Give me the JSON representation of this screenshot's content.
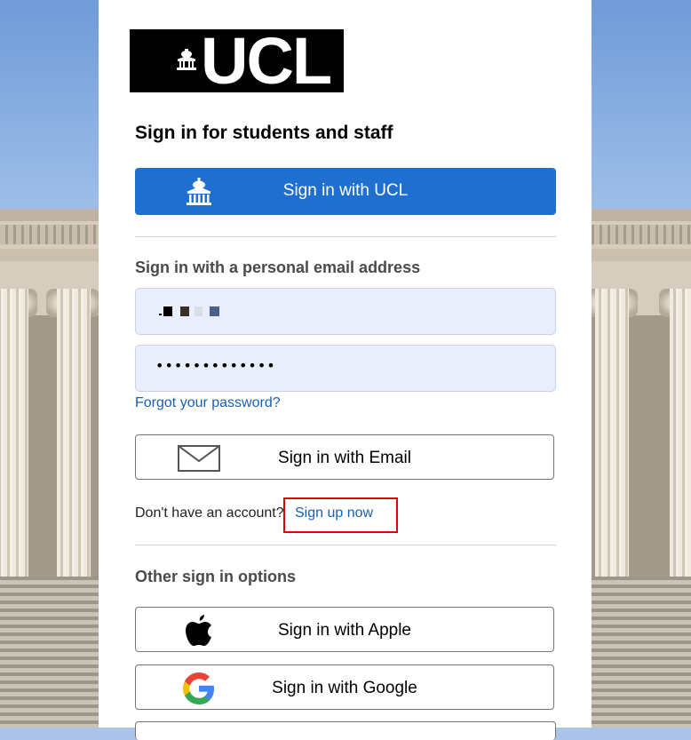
{
  "logo": {
    "text": "UCL"
  },
  "title": "Sign in for students and staff",
  "ucl_button": {
    "label": "Sign in with UCL",
    "icon": "portico-icon"
  },
  "personal_section": {
    "heading": "Sign in with a personal email address"
  },
  "email_field": {
    "value_masked": true
  },
  "password_field": {
    "value": "•••••••••••••"
  },
  "forgot_password": "Forgot your password?",
  "email_button": {
    "label": "Sign in with Email",
    "icon": "envelope-icon"
  },
  "signup": {
    "prompt": "Don't have an account?",
    "link": "Sign up now"
  },
  "other_section": {
    "heading": "Other sign in options"
  },
  "apple_button": {
    "label": "Sign in with Apple",
    "icon": "apple-icon"
  },
  "google_button": {
    "label": "Sign in with Google",
    "icon": "google-icon"
  },
  "colors": {
    "primary": "#1e6fcf",
    "link": "#1a5fb4",
    "highlight": "#e00000",
    "field_bg": "#e8eefc"
  }
}
